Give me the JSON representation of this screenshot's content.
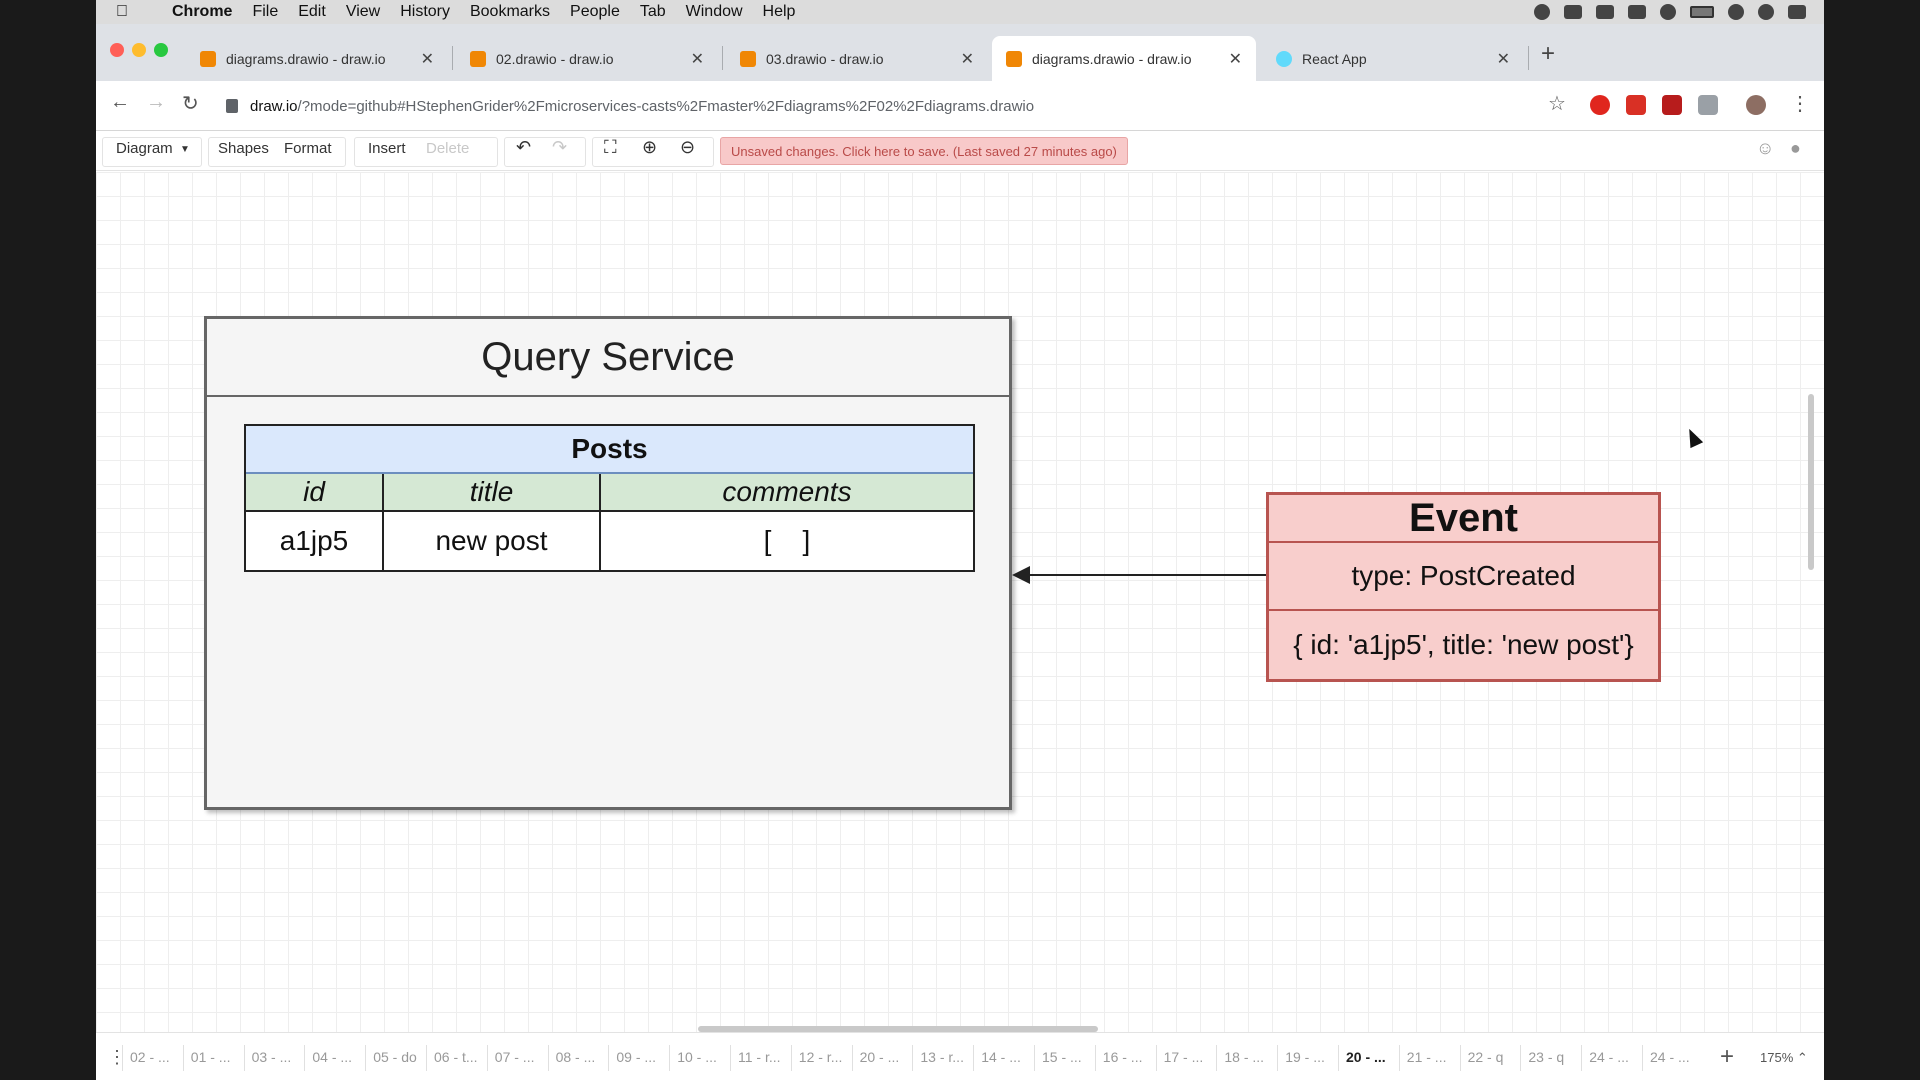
{
  "menubar": {
    "app": "Chrome",
    "items": [
      "File",
      "Edit",
      "View",
      "History",
      "Bookmarks",
      "People",
      "Tab",
      "Window",
      "Help"
    ]
  },
  "tabs": [
    {
      "label": "diagrams.drawio - draw.io",
      "active": false,
      "icon": "drawio-icon"
    },
    {
      "label": "02.drawio - draw.io",
      "active": false,
      "icon": "drawio-icon"
    },
    {
      "label": "03.drawio - draw.io",
      "active": false,
      "icon": "drawio-icon"
    },
    {
      "label": "diagrams.drawio - draw.io",
      "active": true,
      "icon": "drawio-icon"
    },
    {
      "label": "React App",
      "active": false,
      "icon": "react-icon"
    }
  ],
  "address": {
    "host": "draw.io",
    "path": "/?mode=github#HStephenGrider%2Fmicroservices-casts%2Fmaster%2Fdiagrams%2F02%2Fdiagrams.drawio"
  },
  "drawio_toolbar": {
    "diagram": "Diagram",
    "shapes": "Shapes",
    "format": "Format",
    "insert": "Insert",
    "delete": "Delete",
    "save_banner": "Unsaved changes. Click here to save. (Last saved 27 minutes ago)"
  },
  "diagram": {
    "query_service_title": "Query Service",
    "posts_table": {
      "title": "Posts",
      "columns": [
        "id",
        "title",
        "comments"
      ],
      "rows": [
        [
          "a1jp5",
          "new post",
          "[    ]"
        ]
      ]
    },
    "event": {
      "title": "Event",
      "type": "type: PostCreated",
      "data": "{ id: 'a1jp5', title: 'new post'}"
    }
  },
  "page_tabs": [
    "02 - ...",
    "01 - ...",
    "03 - ...",
    "04 - ...",
    "05 - do",
    "06 - t...",
    "07 - ...",
    "08 - ...",
    "09 - ...",
    "10 - ...",
    "11 - r...",
    "12 - r...",
    "20 - ...",
    "13 - r...",
    "14 - ...",
    "15 - ...",
    "16 - ...",
    "17 - ...",
    "18 - ...",
    "19 - ...",
    "20 - ...",
    "21 - ...",
    "22 - q",
    "23 - q",
    "24 - ...",
    "24 - ..."
  ],
  "active_page_index": 20,
  "zoom": "175%",
  "colors": {
    "table_header": "#dae8fc",
    "column_header": "#d5e8d4",
    "event_fill": "#f8cecc",
    "event_stroke": "#b85450",
    "save_banner": "#f8c9c9"
  }
}
